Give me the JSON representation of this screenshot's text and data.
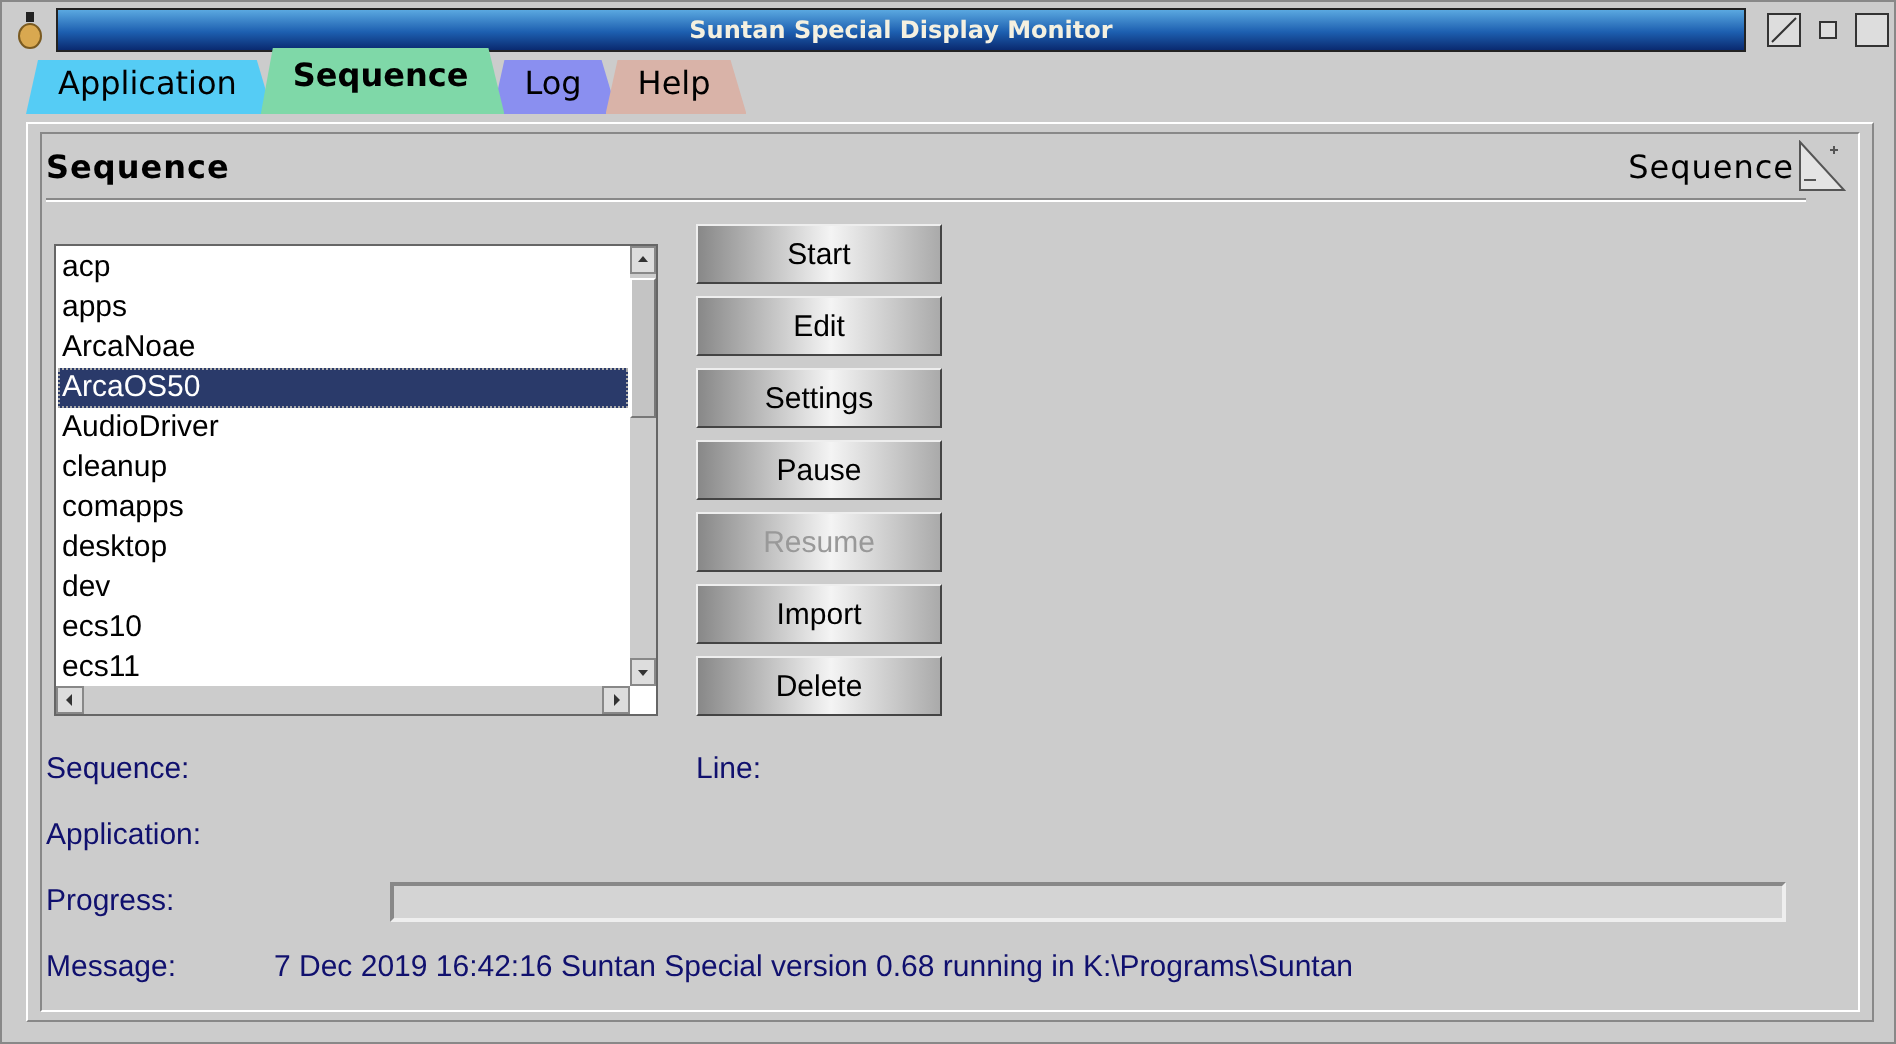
{
  "window": {
    "title": "Suntan Special Display Monitor"
  },
  "tabs": [
    {
      "label": "Application",
      "selected": false,
      "color": "#55ccf5"
    },
    {
      "label": "Sequence",
      "selected": true,
      "color": "#7fd8a8"
    },
    {
      "label": "Log",
      "selected": false,
      "color": "#8a8ff0"
    },
    {
      "label": "Help",
      "selected": false,
      "color": "#d9b3a8"
    }
  ],
  "page": {
    "heading": "Sequence",
    "corner_label": "Sequence"
  },
  "sequences": [
    {
      "name": "acp",
      "selected": false
    },
    {
      "name": "apps",
      "selected": false
    },
    {
      "name": "ArcaNoae",
      "selected": false
    },
    {
      "name": "ArcaOS50",
      "selected": true
    },
    {
      "name": "AudioDriver",
      "selected": false
    },
    {
      "name": "cleanup",
      "selected": false
    },
    {
      "name": "comapps",
      "selected": false
    },
    {
      "name": "desktop",
      "selected": false
    },
    {
      "name": "dev",
      "selected": false
    },
    {
      "name": "ecs10",
      "selected": false
    },
    {
      "name": "ecs11",
      "selected": false
    }
  ],
  "buttons": [
    {
      "label": "Start",
      "disabled": false
    },
    {
      "label": "Edit",
      "disabled": false
    },
    {
      "label": "Settings",
      "disabled": false
    },
    {
      "label": "Pause",
      "disabled": false
    },
    {
      "label": "Resume",
      "disabled": true
    },
    {
      "label": "Import",
      "disabled": false
    },
    {
      "label": "Delete",
      "disabled": false
    }
  ],
  "status": {
    "sequence_label": "Sequence:",
    "line_label": "Line:",
    "application_label": "Application:",
    "progress": {
      "label": "Progress:",
      "level": 0
    },
    "message": {
      "label": "Message:",
      "value": "7 Dec 2019 16:42:16 Suntan Special version 0.68 running in K:\\Programs\\Suntan"
    }
  }
}
